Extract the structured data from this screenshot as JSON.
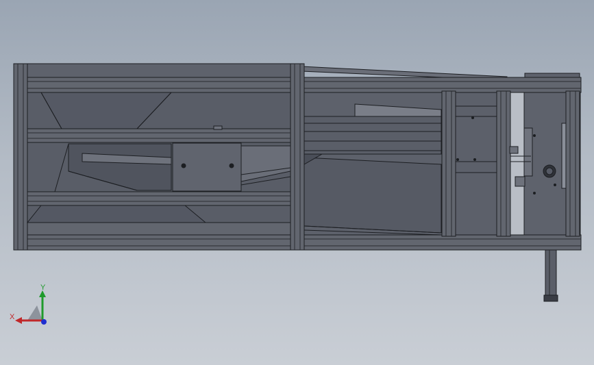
{
  "view": {
    "background_top": "#9aa5b3",
    "background_bottom": "#c9ced5",
    "part_fill": "#5b5f6a",
    "part_dark": "#3a3d45",
    "part_light": "#8a8f99",
    "edge": "#1c1e22"
  },
  "triad": {
    "x_label": "X",
    "y_label": "Y",
    "x_color": "#c0282a",
    "y_color": "#1f9a2c",
    "z_color": "#1f2fd0"
  }
}
